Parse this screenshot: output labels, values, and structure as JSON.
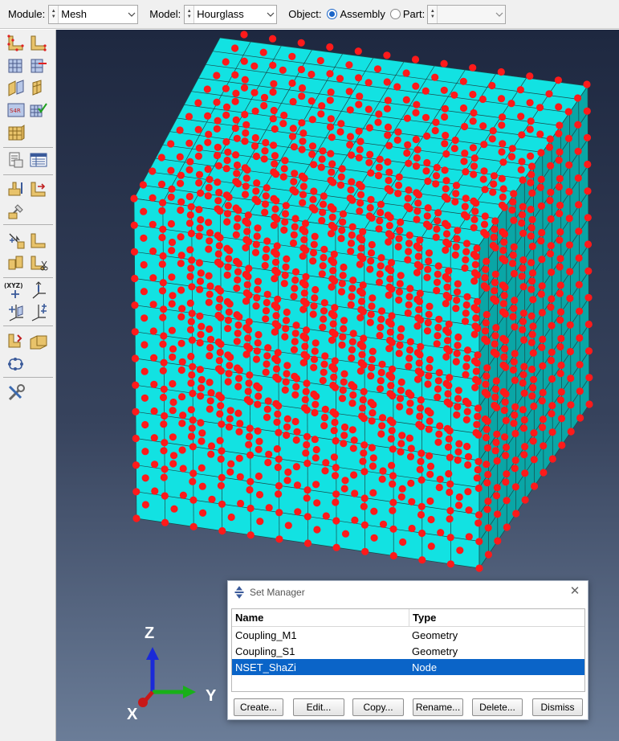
{
  "context_bar": {
    "module_label": "Module:",
    "module_value": "Mesh",
    "model_label": "Model:",
    "model_value": "Hourglass",
    "object_label": "Object:",
    "assembly_label": "Assembly",
    "part_label": "Part:",
    "part_value": "",
    "object_selected": "Assembly"
  },
  "toolbox": {
    "icons": [
      "seed-part-instance-icon",
      "seed-edges-icon",
      "seed-by-number-icon",
      "delete-seeds-icon",
      "mesh-controls-icon",
      "element-type-icon",
      "mesh-part-instance-icon",
      "verify-mesh-icon",
      "assign-mesh-controls-icon",
      "query-mesh-icon",
      "mesh-stats-icon",
      "create-bottom-up-mesh-icon",
      "associate-mesh-icon",
      "partition-cell-icon",
      "virtual-topology-icon",
      "edit-mesh-icon",
      "merge-icon",
      "split-icon",
      "datum-point-icon",
      "datum-axis-icon",
      "datum-plane-icon",
      "datum-csys-icon",
      "boolean-mesh-icon",
      "mesh-region-icon",
      "mesh-edit-icon",
      "tools-icon"
    ],
    "datum_label": "(XYZ)"
  },
  "viewport": {
    "model": "cube-mesh",
    "highlighted_set": "NSET_ShaZi",
    "colors": {
      "mesh_fill": "#12e2e2",
      "node_highlight": "#ff1a1a"
    }
  },
  "triad": {
    "z_label": "Z",
    "y_label": "Y",
    "x_label": "X"
  },
  "set_manager": {
    "title": "Set Manager",
    "col_name": "Name",
    "col_type": "Type",
    "rows": [
      {
        "name": "Coupling_M1",
        "type": "Geometry"
      },
      {
        "name": "Coupling_S1",
        "type": "Geometry"
      },
      {
        "name": "NSET_ShaZi",
        "type": "Node"
      }
    ],
    "selected_index": 2,
    "buttons": {
      "create": "Create...",
      "edit": "Edit...",
      "copy": "Copy...",
      "rename": "Rename...",
      "delete": "Delete...",
      "dismiss": "Dismiss"
    }
  }
}
